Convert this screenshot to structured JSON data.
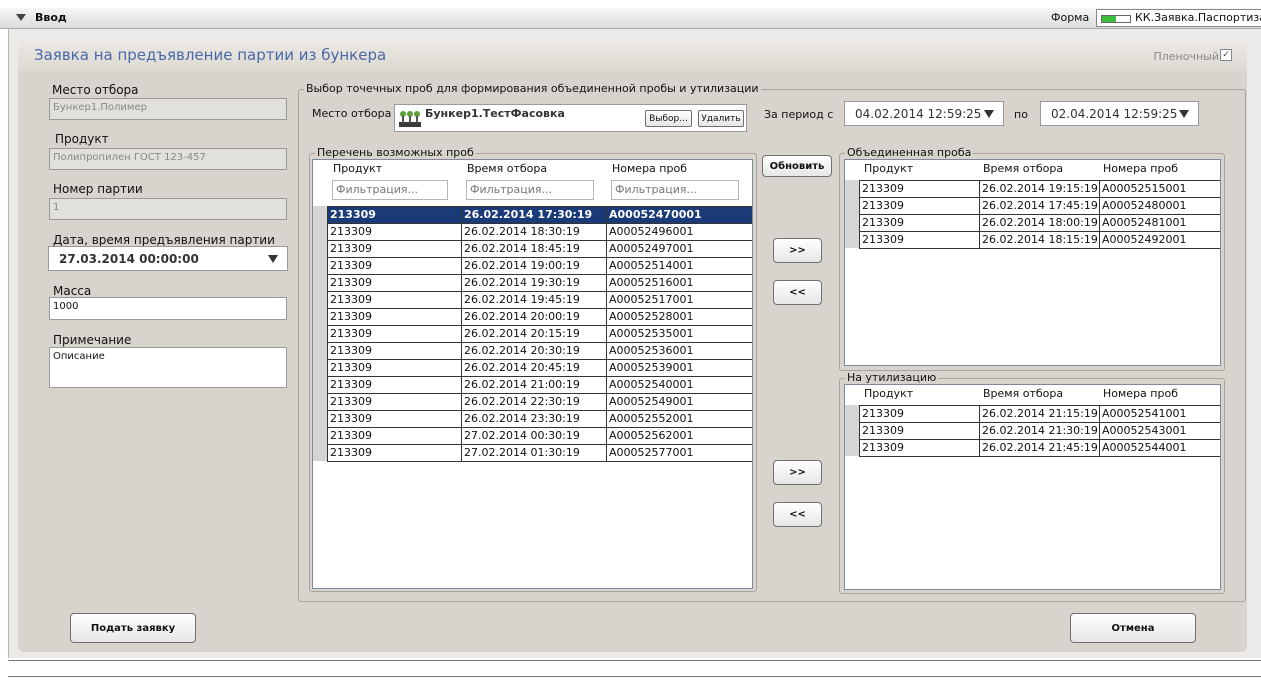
{
  "topbar": {
    "title": "Ввод",
    "form_label": "Форма",
    "form_value": "КК.Заявка.Паспортизаци",
    "progress": 0.5
  },
  "header": {
    "title": "Заявка на предъявление партии из бункера",
    "film_label": "Пленочный",
    "film_checked": true
  },
  "left": {
    "place_label": "Место отбора",
    "place_value": "Бункер1.Полимер",
    "product_label": "Продукт",
    "product_value": "Полипропилен ГОСТ 123-457",
    "lot_label": "Номер партии",
    "lot_value": "1",
    "date_label": "Дата, время предъявления партии",
    "date_value": "27.03.2014  00:00:00",
    "mass_label": "Масса",
    "mass_value": "1000",
    "note_label": "Примечание",
    "note_value": "Описание"
  },
  "selection": {
    "group_label": "Выбор точечных проб для формирования объединенной пробы и утилизации",
    "place_label": "Место отбора",
    "place_value": "Бункер1.ТестФасовка",
    "choose_button": "Выбор...",
    "delete_button": "Удалить",
    "period_label": "За период с",
    "period_from": "04.02.2014  12:59:25",
    "to_label": "по",
    "period_to": "02.04.2014  12:59:25"
  },
  "available": {
    "group_label": "Перечень возможных проб",
    "columns": [
      "Продукт",
      "Время отбора",
      "Номера проб"
    ],
    "filter_placeholder": "Фильтрация...",
    "rows": [
      [
        "213309",
        "26.02.2014 17:30:19",
        "A00052470001"
      ],
      [
        "213309",
        "26.02.2014 18:30:19",
        "A00052496001"
      ],
      [
        "213309",
        "26.02.2014 18:45:19",
        "A00052497001"
      ],
      [
        "213309",
        "26.02.2014 19:00:19",
        "A00052514001"
      ],
      [
        "213309",
        "26.02.2014 19:30:19",
        "A00052516001"
      ],
      [
        "213309",
        "26.02.2014 19:45:19",
        "A00052517001"
      ],
      [
        "213309",
        "26.02.2014 20:00:19",
        "A00052528001"
      ],
      [
        "213309",
        "26.02.2014 20:15:19",
        "A00052535001"
      ],
      [
        "213309",
        "26.02.2014 20:30:19",
        "A00052536001"
      ],
      [
        "213309",
        "26.02.2014 20:45:19",
        "A00052539001"
      ],
      [
        "213309",
        "26.02.2014 21:00:19",
        "A00052540001"
      ],
      [
        "213309",
        "26.02.2014 22:30:19",
        "A00052549001"
      ],
      [
        "213309",
        "26.02.2014 23:30:19",
        "A00052552001"
      ],
      [
        "213309",
        "27.02.2014 00:30:19",
        "A00052562001"
      ],
      [
        "213309",
        "27.02.2014 01:30:19",
        "A00052577001"
      ]
    ]
  },
  "buttons": {
    "refresh": "Обновить",
    "add": ">>",
    "remove": "<<",
    "submit": "Подать заявку",
    "cancel": "Отмена"
  },
  "combined": {
    "group_label": "Объединенная проба",
    "columns": [
      "Продукт",
      "Время отбора",
      "Номера проб"
    ],
    "rows": [
      [
        "213309",
        "26.02.2014 19:15:19",
        "A00052515001"
      ],
      [
        "213309",
        "26.02.2014 17:45:19",
        "A00052480001"
      ],
      [
        "213309",
        "26.02.2014 18:00:19",
        "A00052481001"
      ],
      [
        "213309",
        "26.02.2014 18:15:19",
        "A00052492001"
      ]
    ]
  },
  "disposal": {
    "group_label": "На утилизацию",
    "columns": [
      "Продукт",
      "Время отбора",
      "Номера проб"
    ],
    "rows": [
      [
        "213309",
        "26.02.2014 21:15:19",
        "A00052541001"
      ],
      [
        "213309",
        "26.02.2014 21:30:19",
        "A00052543001"
      ],
      [
        "213309",
        "26.02.2014 21:45:19",
        "A00052544001"
      ]
    ]
  }
}
